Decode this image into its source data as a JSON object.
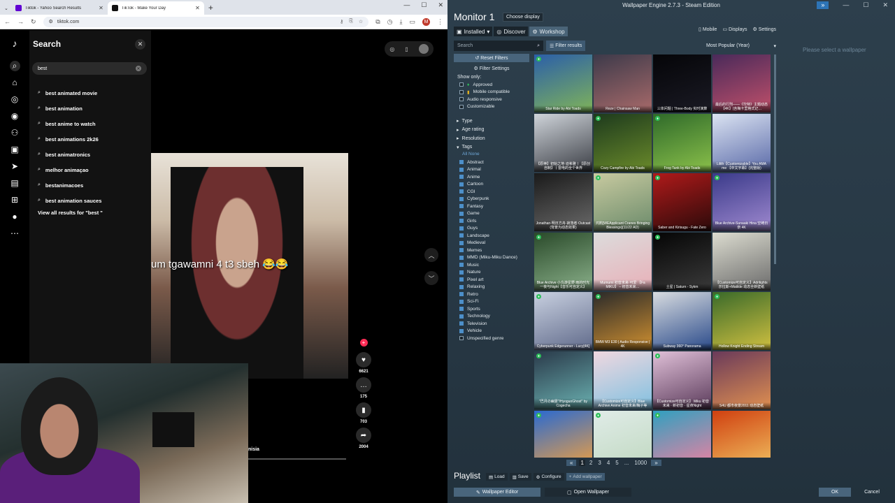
{
  "chrome": {
    "tabs": [
      {
        "title": "Tiktok - Yahoo Search Results",
        "favicon_color": "#6001d2"
      },
      {
        "title": "TikTok - Make Your Day",
        "favicon_color": "#111111"
      }
    ],
    "url": "tiktok.com",
    "profile_initial": "M"
  },
  "tiktok": {
    "search_title": "Search",
    "search_value": "best",
    "suggestions": [
      "best animated movie",
      "best animation",
      "best anime to watch",
      "best animations 2k26",
      "best animatronics",
      "melhor animaçao",
      "bestanimacoes",
      "best animation sauces"
    ],
    "view_all": "View all results for \"best \"",
    "video_caption": "um tgawamni 4 t3 sbeh 😂😂",
    "likes": "6621",
    "comments": "175",
    "saves": "703",
    "shares": "2004",
    "location_text": "nisia"
  },
  "we": {
    "window_title": "Wallpaper Engine 2.7.3 - Steam Edition",
    "monitor": "Monitor 1",
    "choose_display": "Choose display",
    "tabs": [
      "Installed",
      "Discover",
      "Workshop"
    ],
    "top_right": [
      "Mobile",
      "Displays",
      "Settings"
    ],
    "search_placeholder": "Search",
    "filter_results": "Filter results",
    "sort": "Most Popular (Year)",
    "please_select": "Please select a wallpaper",
    "reset_filters": "Reset Filters",
    "filter_settings": "Filter Settings",
    "show_only": "Show only:",
    "show_only_items": [
      "Approved",
      "Mobile compatible",
      "Audio responsive",
      "Customizable"
    ],
    "sections": [
      "Type",
      "Age rating",
      "Resolution",
      "Tags"
    ],
    "all_none": "All None",
    "tags": [
      "Abstract",
      "Animal",
      "Anime",
      "Cartoon",
      "CGI",
      "Cyberpunk",
      "Fantasy",
      "Game",
      "Girls",
      "Guys",
      "Landscape",
      "Medieval",
      "Memes",
      "MMD (Miku-Miku Dance)",
      "Music",
      "Nature",
      "Pixel art",
      "Relaxing",
      "Retro",
      "Sci-Fi",
      "Sports",
      "Technology",
      "Television",
      "Vehicle",
      "Unspecified genre"
    ],
    "tiles": [
      {
        "label": "Star Ride by Abi Toads",
        "c1": "#2b5fa8",
        "c2": "#7fb35a",
        "badge": true
      },
      {
        "label": "Reze | Chainsaw Man",
        "c1": "#3d3a4a",
        "c2": "#a86a6a",
        "badge": false
      },
      {
        "label": "三体问题 | Three-Body 实时演算",
        "c1": "#050508",
        "c2": "#1a1a24",
        "badge": false
      },
      {
        "label": "最后的行刑——《坎特》主题动态【4K】(含梅卡里格式记…",
        "c1": "#4a2a5a",
        "c2": "#c0506a",
        "badge": false
      },
      {
        "label": "【原神】初始之地·迪希雅丨【原创自制】丨雷电的全个世界",
        "c1": "#cfd4da",
        "c2": "#3a3d44",
        "badge": false
      },
      {
        "label": "Cozy Campfire by Abi Toads",
        "c1": "#1d3a1d",
        "c2": "#6a8a2a",
        "badge": true
      },
      {
        "label": "Frog Tank by Abi Toads",
        "c1": "#2f6a2a",
        "c2": "#8ac04a",
        "badge": true
      },
      {
        "label": "Lilith【Customizable】You AMA me 【中文字幕】(完整版)",
        "c1": "#dbe3f2",
        "c2": "#5a6aa8",
        "badge": false
      },
      {
        "label": "Jonathan·明日方舟·寂落者·Outcast (背景为动态效果)",
        "c1": "#1a1a1a",
        "c2": "#6a6a6a",
        "badge": false
      },
      {
        "label": "鸿鹄[WEApplicant Cranes Bringing Blessings](11/22 AD)",
        "c1": "#c8caa0",
        "c2": "#6a8a6a",
        "badge": true
      },
      {
        "label": "Saber and Kirisugu - Fate Zero",
        "c1": "#b01a1a",
        "c2": "#2a0a0a",
        "badge": true
      },
      {
        "label": "Blue Archive-Sunaaki Hina 空崎日奈 4K",
        "c1": "#3a3a8a",
        "c2": "#a08ad0",
        "badge": true
      },
      {
        "label": "Blue Archive 小鸟游星野 雨的时光一夜与Night【音乐可自定义】",
        "c1": "#2a4a2a",
        "c2": "#8ab08a",
        "badge": true
      },
      {
        "label": "Mumumi 初音未来·可爱 【Fa MIKU】 – 初音未来…",
        "c1": "#dcdcdc",
        "c2": "#e8b0b8",
        "badge": false
      },
      {
        "label": "土星 | Saturn - Sykm",
        "c1": "#050505",
        "c2": "#3a3a3a",
        "badge": true
      },
      {
        "label": "【Customize可自定义】Adrilights 莎拉斯+Matilde 动态全新壁纸",
        "c1": "#dcdcd0",
        "c2": "#6a6a6a",
        "badge": false
      },
      {
        "label": "Cyberpunk Edgerunner - Lucy[4K]",
        "c1": "#c8d0e0",
        "c2": "#606a8a",
        "badge": true
      },
      {
        "label": "BMW M3 E30 | Audio Responsive | 4K",
        "c1": "#2a2a2a",
        "c2": "#d09030",
        "badge": true
      },
      {
        "label": "Subway 360° Panorama",
        "c1": "#d8dce0",
        "c2": "#2a4a8a",
        "badge": false
      },
      {
        "label": "Hollow Knight Ending Stream",
        "c1": "#3a6a2a",
        "c2": "#d0c040",
        "badge": true
      },
      {
        "label": "\"巴月の幽霊\"/HyoguoGhost\" by Cogecha",
        "c1": "#2a3a4a",
        "c2": "#6ab0b0",
        "badge": true
      },
      {
        "label": "【Customize可自定义】Blue Archive Anime 初音未来/梅子等",
        "c1": "#f0d8e0",
        "c2": "#80c0e0",
        "badge": false
      },
      {
        "label": "【Customize可自定义】 Miku 初音未来 · 新初音 · 星夜Night",
        "c1": "#e0c0d8",
        "c2": "#5a3a5a",
        "badge": true
      },
      {
        "label": "S4U 都市夜景2011 动态壁纸",
        "c1": "#6a3a5a",
        "c2": "#e09050",
        "badge": false
      },
      {
        "label": "",
        "c1": "#2a6ad0",
        "c2": "#f0a040",
        "badge": true
      },
      {
        "label": "",
        "c1": "#e0ece8",
        "c2": "#c0d8c0",
        "badge": true
      },
      {
        "label": "",
        "c1": "#30a0c0",
        "c2": "#f080a0",
        "badge": true
      },
      {
        "label": "",
        "c1": "#d04010",
        "c2": "#f0c060",
        "badge": false
      }
    ],
    "pages": [
      "1",
      "2",
      "3",
      "4",
      "5",
      "...",
      "1000"
    ],
    "current_page": "1",
    "playlist": "Playlist",
    "playlist_buttons": [
      "Load",
      "Save",
      "Configure",
      "Add wallpaper"
    ],
    "wallpaper_editor": "Wallpaper Editor",
    "open_wallpaper": "Open Wallpaper",
    "ok": "OK",
    "cancel": "Cancel"
  }
}
